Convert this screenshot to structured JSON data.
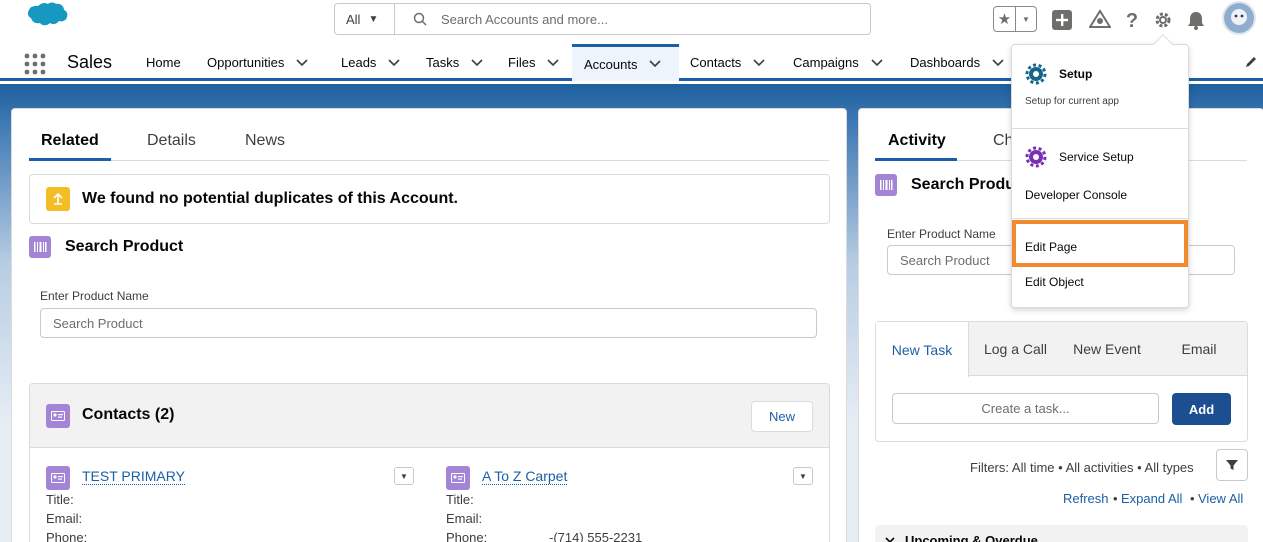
{
  "header": {
    "search_scope": "All",
    "search_placeholder": "Search Accounts and more...",
    "icons": [
      "salesforce-logo",
      "search-icon",
      "star-icon",
      "add-icon",
      "trailhead-icon",
      "help-icon",
      "gear-icon",
      "bell-icon",
      "avatar"
    ]
  },
  "nav": {
    "app_name": "Sales",
    "items": [
      {
        "label": "Home"
      },
      {
        "label": "Opportunities"
      },
      {
        "label": "Leads"
      },
      {
        "label": "Tasks"
      },
      {
        "label": "Files"
      },
      {
        "label": "Accounts"
      },
      {
        "label": "Contacts"
      },
      {
        "label": "Campaigns"
      },
      {
        "label": "Dashboards"
      }
    ],
    "active": "Accounts"
  },
  "left": {
    "tabs": [
      "Related",
      "Details",
      "News"
    ],
    "duplicate_message": "We found no potential duplicates of this Account.",
    "search_product": {
      "title": "Search Product",
      "label": "Enter Product Name",
      "placeholder": "Search Product"
    },
    "contacts": {
      "title": "Contacts (2)",
      "new_label": "New",
      "items": [
        {
          "name": "TEST PRIMARY",
          "title_label": "Title:",
          "email_label": "Email:",
          "phone_label": "Phone:",
          "phone": ""
        },
        {
          "name": "A To Z Carpet",
          "title_label": "Title:",
          "email_label": "Email:",
          "phone_label": "Phone:",
          "phone": "-(714) 555-2231"
        }
      ]
    }
  },
  "right": {
    "tabs": [
      "Activity",
      "Ch"
    ],
    "search_product": {
      "title": "Search Produ",
      "label": "Enter Product Name",
      "placeholder": "Search Product"
    },
    "publisher_tabs": [
      "New Task",
      "Log a Call",
      "New Event",
      "Email"
    ],
    "task_placeholder": "Create a task...",
    "add_label": "Add",
    "filters": "Filters: All time • All activities • All types",
    "links": [
      "Refresh",
      "Expand All",
      "View All"
    ],
    "upcoming": "Upcoming & Overdue"
  },
  "menu": {
    "setup": "Setup",
    "setup_sub": "Setup for current app",
    "service_setup": "Service Setup",
    "developer_console": "Developer Console",
    "edit_page": "Edit Page",
    "edit_object": "Edit Object"
  },
  "colors": {
    "brand": "#1b5fa6",
    "add_button": "#1b4f91",
    "highlight": "#ef8a2e",
    "setup_gear": "#16668c",
    "service_gear": "#7b2fb5",
    "duplicate_badge": "#f4bc25",
    "product_icon": "#a484d6"
  }
}
